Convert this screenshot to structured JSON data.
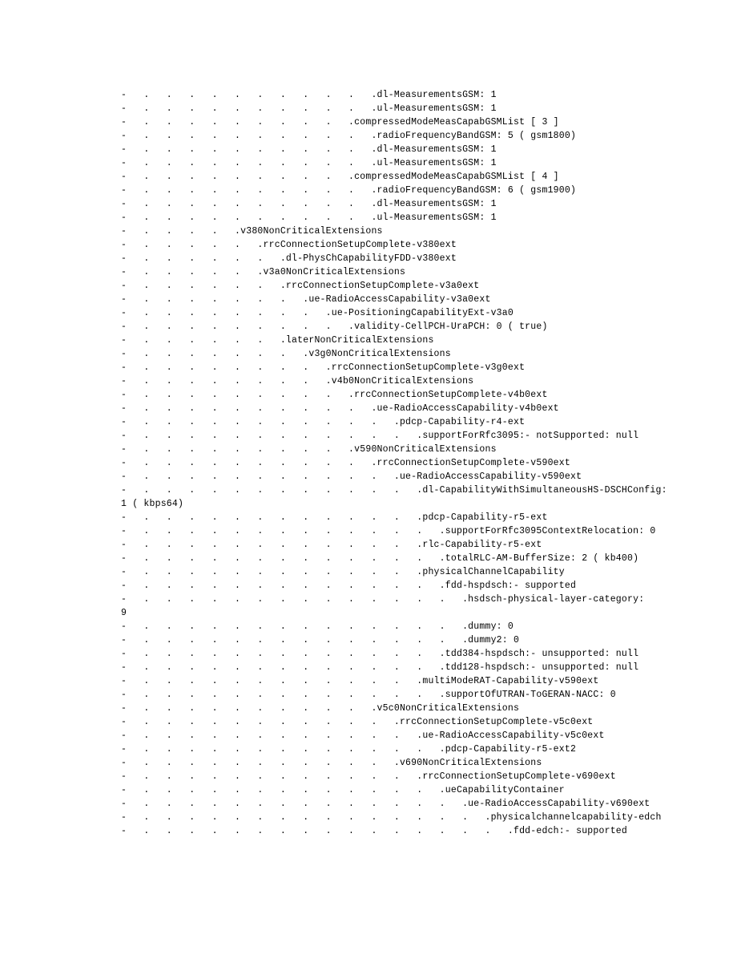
{
  "dot": ".   ",
  "lines": [
    {
      "i": 10,
      "t": ".dl-MeasurementsGSM: 1"
    },
    {
      "i": 10,
      "t": ".ul-MeasurementsGSM: 1"
    },
    {
      "i": 9,
      "t": ".compressedModeMeasCapabGSMList [ 3 ]"
    },
    {
      "i": 10,
      "t": ".radioFrequencyBandGSM: 5 ( gsm1800)"
    },
    {
      "i": 10,
      "t": ".dl-MeasurementsGSM: 1"
    },
    {
      "i": 10,
      "t": ".ul-MeasurementsGSM: 1"
    },
    {
      "i": 9,
      "t": ".compressedModeMeasCapabGSMList [ 4 ]"
    },
    {
      "i": 10,
      "t": ".radioFrequencyBandGSM: 6 ( gsm1900)"
    },
    {
      "i": 10,
      "t": ".dl-MeasurementsGSM: 1"
    },
    {
      "i": 10,
      "t": ".ul-MeasurementsGSM: 1"
    },
    {
      "i": 4,
      "t": ".v380NonCriticalExtensions"
    },
    {
      "i": 5,
      "t": ".rrcConnectionSetupComplete-v380ext"
    },
    {
      "i": 6,
      "t": ".dl-PhysChCapabilityFDD-v380ext"
    },
    {
      "i": 5,
      "t": ".v3a0NonCriticalExtensions"
    },
    {
      "i": 6,
      "t": ".rrcConnectionSetupComplete-v3a0ext"
    },
    {
      "i": 7,
      "t": ".ue-RadioAccessCapability-v3a0ext"
    },
    {
      "i": 8,
      "t": ".ue-PositioningCapabilityExt-v3a0"
    },
    {
      "i": 9,
      "t": ".validity-CellPCH-UraPCH: 0 ( true)"
    },
    {
      "i": 6,
      "t": ".laterNonCriticalExtensions"
    },
    {
      "i": 7,
      "t": ".v3g0NonCriticalExtensions"
    },
    {
      "i": 8,
      "t": ".rrcConnectionSetupComplete-v3g0ext"
    },
    {
      "i": 8,
      "t": ".v4b0NonCriticalExtensions"
    },
    {
      "i": 9,
      "t": ".rrcConnectionSetupComplete-v4b0ext"
    },
    {
      "i": 10,
      "t": ".ue-RadioAccessCapability-v4b0ext"
    },
    {
      "i": 11,
      "t": ".pdcp-Capability-r4-ext"
    },
    {
      "i": 12,
      "t": ".supportForRfc3095:- notSupported: null"
    },
    {
      "i": 9,
      "t": ".v590NonCriticalExtensions"
    },
    {
      "i": 10,
      "t": ".rrcConnectionSetupComplete-v590ext"
    },
    {
      "i": 11,
      "t": ".ue-RadioAccessCapability-v590ext"
    },
    {
      "i": 12,
      "t": ".dl-CapabilityWithSimultaneousHS-DSCHConfig:",
      "wrap": "1 ( kbps64)"
    },
    {
      "i": 12,
      "t": ".pdcp-Capability-r5-ext"
    },
    {
      "i": 13,
      "t": ".supportForRfc3095ContextRelocation: 0"
    },
    {
      "i": 12,
      "t": ".rlc-Capability-r5-ext"
    },
    {
      "i": 13,
      "t": ".totalRLC-AM-BufferSize: 2 ( kb400)"
    },
    {
      "i": 12,
      "t": ".physicalChannelCapability"
    },
    {
      "i": 13,
      "t": ".fdd-hspdsch:- supported"
    },
    {
      "i": 14,
      "t": ".hsdsch-physical-layer-category:",
      "wrap": "9"
    },
    {
      "i": 14,
      "t": ".dummy: 0"
    },
    {
      "i": 14,
      "t": ".dummy2: 0"
    },
    {
      "i": 13,
      "t": ".tdd384-hspdsch:- unsupported: null"
    },
    {
      "i": 13,
      "t": ".tdd128-hspdsch:- unsupported: null"
    },
    {
      "i": 12,
      "t": ".multiModeRAT-Capability-v590ext"
    },
    {
      "i": 13,
      "t": ".supportOfUTRAN-ToGERAN-NACC: 0"
    },
    {
      "i": 10,
      "t": ".v5c0NonCriticalExtensions"
    },
    {
      "i": 11,
      "t": ".rrcConnectionSetupComplete-v5c0ext"
    },
    {
      "i": 12,
      "t": ".ue-RadioAccessCapability-v5c0ext"
    },
    {
      "i": 13,
      "t": ".pdcp-Capability-r5-ext2"
    },
    {
      "i": 11,
      "t": ".v690NonCriticalExtensions"
    },
    {
      "i": 12,
      "t": ".rrcConnectionSetupComplete-v690ext"
    },
    {
      "i": 13,
      "t": ".ueCapabilityContainer"
    },
    {
      "i": 14,
      "t": ".ue-RadioAccessCapability-v690ext"
    },
    {
      "i": 15,
      "t": ".physicalchannelcapability-edch"
    },
    {
      "i": 16,
      "t": ".fdd-edch:- supported"
    }
  ]
}
